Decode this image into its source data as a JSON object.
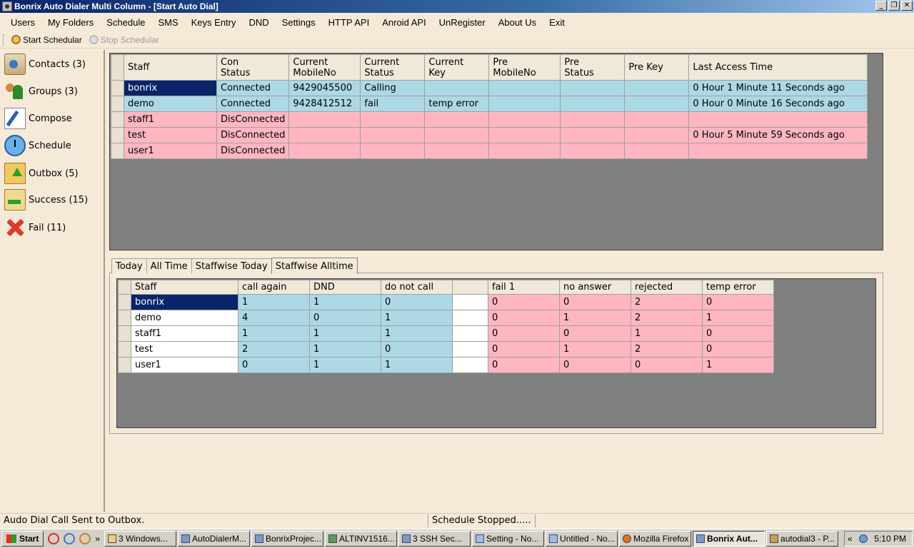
{
  "window": {
    "title": "Bonrix Auto Dialer Multi Column - [Start Auto Dial]",
    "min": "_",
    "restore": "❐",
    "close": "✕"
  },
  "menu": [
    "Users",
    "My Folders",
    "Schedule",
    "SMS",
    "Keys Entry",
    "DND",
    "Settings",
    "HTTP API",
    "Anroid API",
    "UnRegister",
    "About Us",
    "Exit"
  ],
  "toolbar": {
    "start": "Start Schedular",
    "stop": "Stop Schedular"
  },
  "sidebar": [
    {
      "label": "Contacts (3)",
      "icon": "contacts-icon"
    },
    {
      "label": "Groups (3)",
      "icon": "groups-icon"
    },
    {
      "label": "Compose",
      "icon": "compose-icon"
    },
    {
      "label": "Schedule",
      "icon": "schedule-icon"
    },
    {
      "label": "Outbox (5)",
      "icon": "outbox-icon"
    },
    {
      "label": "Success (15)",
      "icon": "success-icon"
    },
    {
      "label": "Fail (11)",
      "icon": "fail-icon"
    }
  ],
  "staff_grid": {
    "columns": [
      {
        "l1": "Staff",
        "l2": ""
      },
      {
        "l1": "Con",
        "l2": "Status"
      },
      {
        "l1": "Current",
        "l2": "MobileNo"
      },
      {
        "l1": "Current",
        "l2": "Status"
      },
      {
        "l1": "Current",
        "l2": "Key"
      },
      {
        "l1": "Pre",
        "l2": "MobileNo"
      },
      {
        "l1": "Pre",
        "l2": "Status"
      },
      {
        "l1": "Pre Key",
        "l2": ""
      },
      {
        "l1": "Last Access Time",
        "l2": ""
      }
    ],
    "rows": [
      {
        "state": "connected",
        "cells": [
          "bonrix",
          "Connected",
          "9429045500",
          "Calling",
          "",
          "",
          "",
          "",
          "0 Hour 1 Minute 11 Seconds ago"
        ]
      },
      {
        "state": "connected",
        "cells": [
          "demo",
          "Connected",
          "9428412512",
          "fail",
          "temp error",
          "",
          "",
          "",
          "0 Hour 0 Minute 16 Seconds ago"
        ]
      },
      {
        "state": "disconnected",
        "cells": [
          "staff1",
          "DisConnected",
          "",
          "",
          "",
          "",
          "",
          "",
          ""
        ]
      },
      {
        "state": "disconnected",
        "cells": [
          "test",
          "DisConnected",
          "",
          "",
          "",
          "",
          "",
          "",
          "0 Hour 5 Minute 59 Seconds ago"
        ]
      },
      {
        "state": "disconnected",
        "cells": [
          "user1",
          "DisConnected",
          "",
          "",
          "",
          "",
          "",
          "",
          ""
        ]
      }
    ]
  },
  "tabs": [
    "Today",
    "All Time",
    "Staffwise Today",
    "Staffwise Alltime"
  ],
  "active_tab": "Staffwise Alltime",
  "stats_grid": {
    "columns": [
      "Staff",
      "call again",
      "DND",
      "do not call",
      "",
      "fail 1",
      "no answer",
      "rejected",
      "temp error"
    ],
    "rows": [
      [
        "bonrix",
        "1",
        "1",
        "0",
        "",
        "0",
        "0",
        "2",
        "0"
      ],
      [
        "demo",
        "4",
        "0",
        "1",
        "",
        "0",
        "1",
        "2",
        "1"
      ],
      [
        "staff1",
        "1",
        "1",
        "1",
        "",
        "0",
        "0",
        "1",
        "0"
      ],
      [
        "test",
        "2",
        "1",
        "0",
        "",
        "0",
        "1",
        "2",
        "0"
      ],
      [
        "user1",
        "0",
        "1",
        "1",
        "",
        "0",
        "0",
        "0",
        "1"
      ]
    ]
  },
  "status": {
    "left": "Audo Dial Call Sent to Outbox.",
    "right": "Schedule Stopped....."
  },
  "taskbar": {
    "start": "Start",
    "quick_launch_more": "»",
    "tasks": [
      "3 Windows...",
      "AutoDialerM...",
      "BonrixProjec...",
      "ALTINV1516...",
      "3 SSH Sec...",
      "Setting - No...",
      "Untitled - No...",
      "Mozilla Firefox",
      "Bonrix Aut...",
      "autodial3 - P..."
    ],
    "active_task": "Bonrix Aut...",
    "tray_expand": "«",
    "clock": "5:10 PM"
  },
  "colors": {
    "connected": "#add8e6",
    "disconnected": "#ffb6c1",
    "selected": "#0a246a",
    "grid_bg": "#808080",
    "window_bg": "#f5ead8"
  }
}
